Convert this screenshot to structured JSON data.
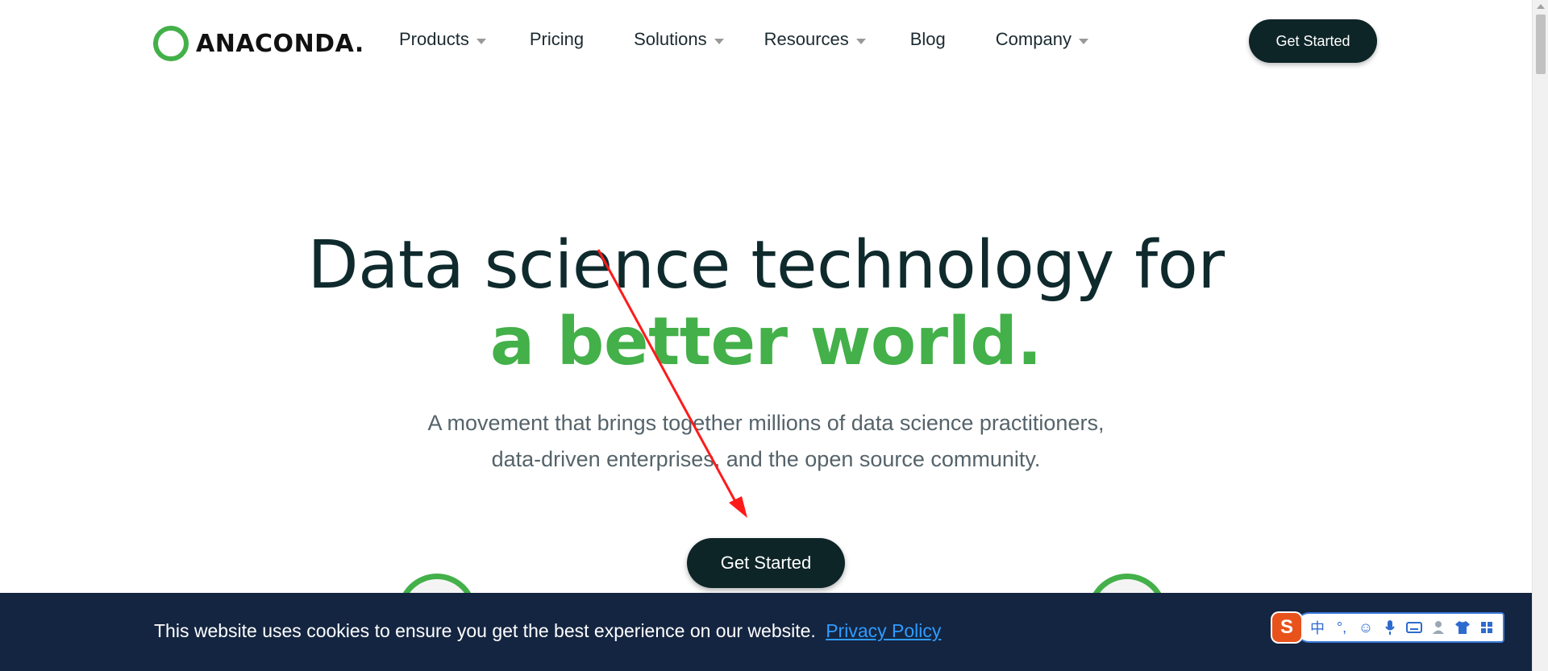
{
  "header": {
    "logo_text": "ANACONDA.",
    "nav": [
      {
        "label": "Products",
        "dropdown": true
      },
      {
        "label": "Pricing",
        "dropdown": false
      },
      {
        "label": "Solutions",
        "dropdown": true
      },
      {
        "label": "Resources",
        "dropdown": true
      },
      {
        "label": "Blog",
        "dropdown": false
      },
      {
        "label": "Company",
        "dropdown": true
      }
    ],
    "cta_label": "Get Started"
  },
  "hero": {
    "title_line1": "Data science technology for",
    "title_line2": "a better world.",
    "subtitle_line1": "A movement that brings together millions of data science practitioners,",
    "subtitle_line2": "data-driven enterprises, and the open source community.",
    "cta_label": "Get Started"
  },
  "cookie_banner": {
    "text": "This website uses cookies to ensure you get the best experience on our website.",
    "link_label": "Privacy Policy"
  },
  "ime_toolbar": {
    "logo": "S",
    "items": [
      {
        "icon": "chinese-mode-icon",
        "glyph": "中"
      },
      {
        "icon": "punctuation-icon",
        "glyph": "°,"
      },
      {
        "icon": "emoji-icon",
        "glyph": "☺"
      },
      {
        "icon": "microphone-icon",
        "glyph": "🎤"
      },
      {
        "icon": "keyboard-icon",
        "glyph": "⌨"
      },
      {
        "icon": "user-icon",
        "glyph": "👤"
      },
      {
        "icon": "skin-icon",
        "glyph": "👕"
      },
      {
        "icon": "menu-grid-icon",
        "glyph": "▦"
      }
    ]
  },
  "colors": {
    "brand_green": "#43b049",
    "dark_button": "#0e2528",
    "cookie_bg": "#142541",
    "link_blue": "#2f9bff",
    "annotation_red": "#ff1a1a"
  }
}
